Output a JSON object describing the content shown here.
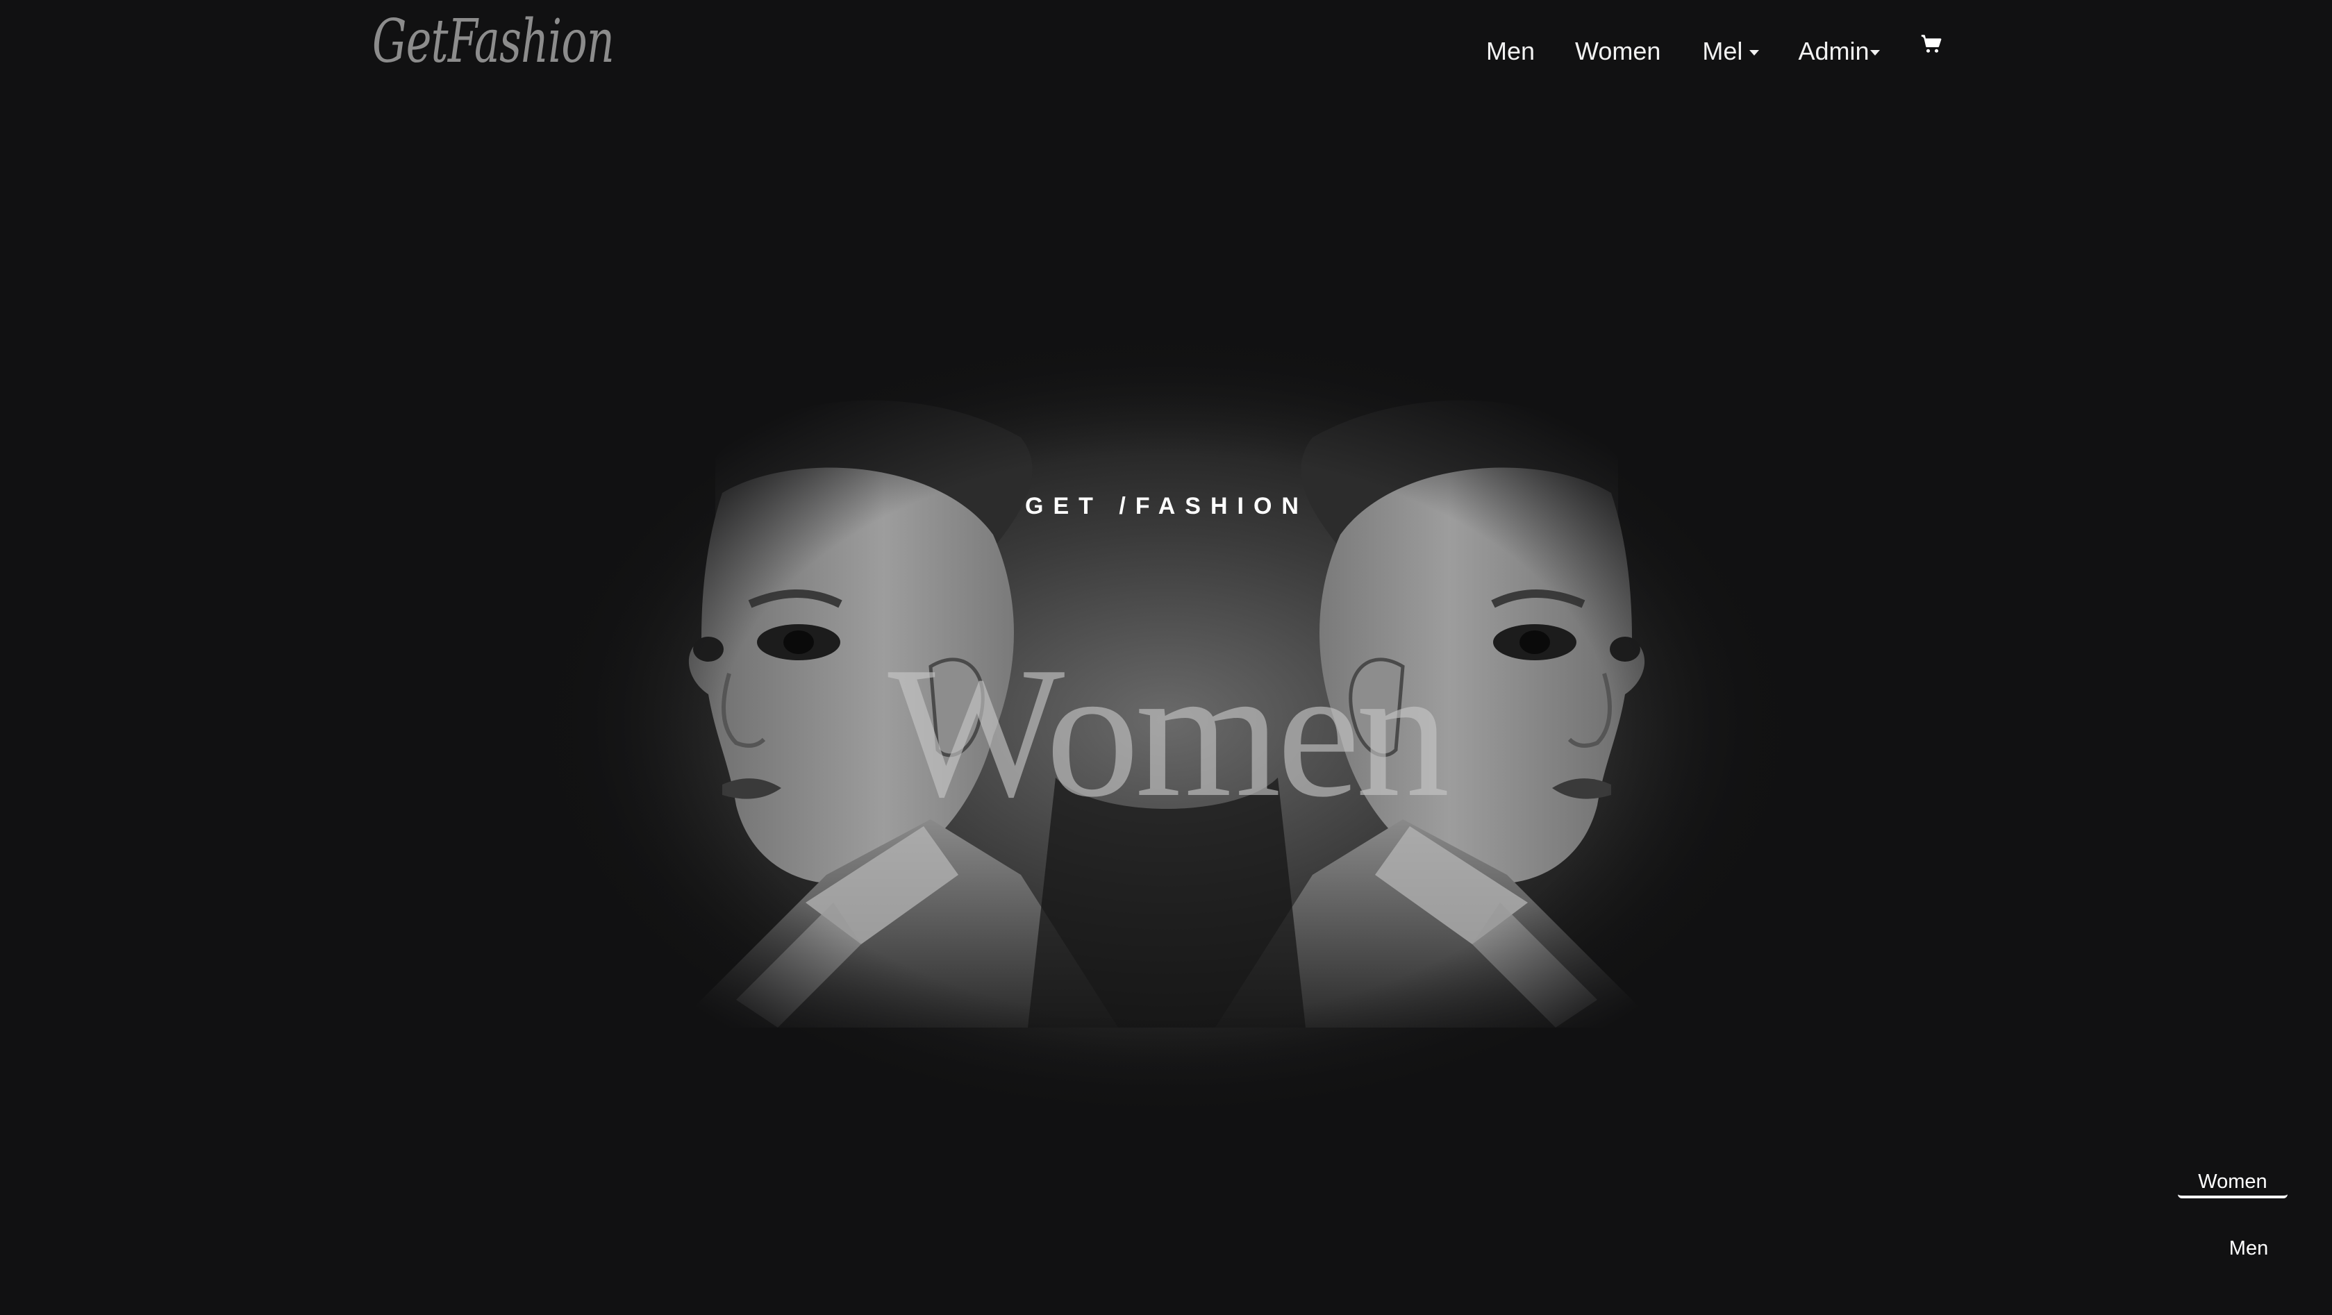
{
  "brand": {
    "logo_text": "GetFashion"
  },
  "nav": {
    "men": "Men",
    "women": "Women",
    "mel": "Mel",
    "admin": "Admin",
    "cart_icon": "shopping-cart-icon"
  },
  "hero": {
    "kicker": "GET /FASHION",
    "title": "Women",
    "image": "mirrored-woman-portrait"
  },
  "side_tabs": {
    "women": "Women",
    "men": "Men"
  },
  "colors": {
    "background": "#111112",
    "nav_text": "#f2f2f2",
    "logo": "#8c8c8c"
  }
}
